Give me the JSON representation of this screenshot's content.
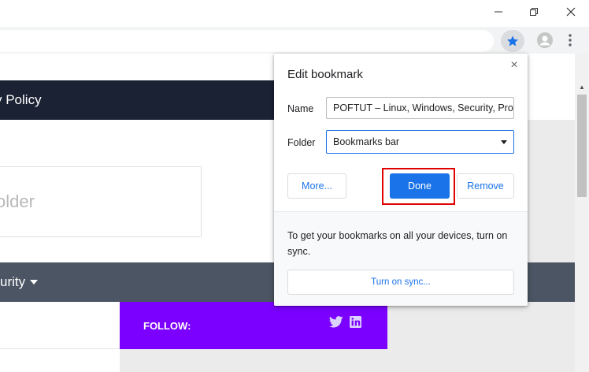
{
  "window_controls": {
    "minimize": "—",
    "maximize": "❐",
    "close": "✕"
  },
  "toolbar": {
    "bookmark_icon": "star-icon",
    "profile_icon": "account-icon",
    "menu_icon": "kebab-menu-icon"
  },
  "page": {
    "nav_fragment": "y Policy",
    "search_fragment": "older",
    "menu_fragment": "urity",
    "follow_label": "FOLLOW:",
    "follow_icons": [
      "twitter-icon",
      "linkedin-icon"
    ],
    "accent_color": "#7b00ff"
  },
  "dialog": {
    "title": "Edit bookmark",
    "name_label": "Name",
    "name_value": "POFTUT – Linux, Windows, Security, Progr",
    "folder_label": "Folder",
    "folder_value": "Bookmarks bar",
    "more_button": "More...",
    "done_button": "Done",
    "remove_button": "Remove",
    "sync_text": "To get your bookmarks on all your devices, turn on sync.",
    "sync_button": "Turn on sync...",
    "close_icon": "×",
    "highlight_color": "#e00000",
    "primary_color": "#1a73e8"
  }
}
